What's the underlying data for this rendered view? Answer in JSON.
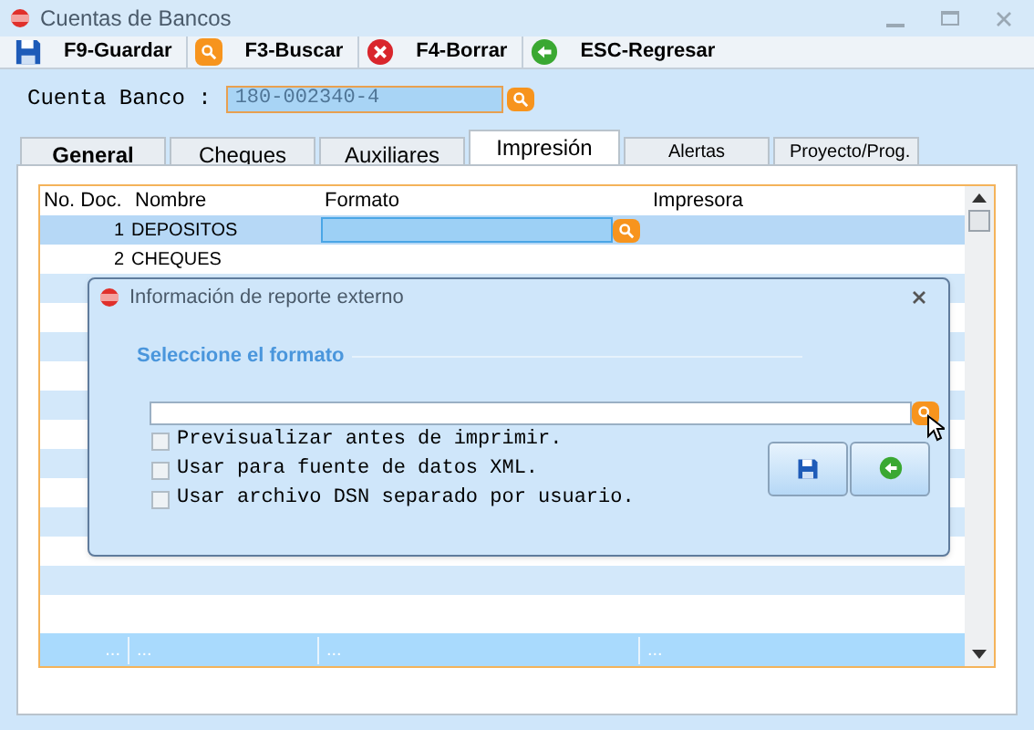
{
  "window": {
    "title": "Cuentas de Bancos"
  },
  "toolbar": [
    {
      "label": "F9-Guardar",
      "kind": "save"
    },
    {
      "label": "F3-Buscar",
      "kind": "search"
    },
    {
      "label": "F4-Borrar",
      "kind": "delete"
    },
    {
      "label": "ESC-Regresar",
      "kind": "back"
    }
  ],
  "account": {
    "label": "Cuenta Banco :",
    "value": "180-002340-4"
  },
  "tabs": [
    {
      "label": "General",
      "selected": false
    },
    {
      "label": "Cheques",
      "selected": false
    },
    {
      "label": "Auxiliares",
      "selected": false
    },
    {
      "label": "Impresión",
      "selected": true
    },
    {
      "label": "Alertas",
      "selected": false
    },
    {
      "label": "Proyecto/Prog.",
      "selected": false
    }
  ],
  "grid": {
    "columns": [
      "No. Doc.",
      "Nombre",
      "Formato",
      "Impresora"
    ],
    "rows": [
      {
        "number": "1",
        "name": "DEPOSITOS",
        "selected": true
      },
      {
        "number": "2",
        "name": "CHEQUES",
        "selected": false
      }
    ],
    "footer": [
      "...",
      "...",
      "...",
      "..."
    ]
  },
  "dialog": {
    "title": "Información de reporte externo",
    "section": "Seleccione el formato",
    "options": [
      {
        "label": "Previsualizar antes de imprimir.",
        "checked": false
      },
      {
        "label": "Usar para fuente de datos XML.",
        "checked": false
      },
      {
        "label": "Usar archivo DSN separado por usuario.",
        "checked": false
      }
    ]
  }
}
